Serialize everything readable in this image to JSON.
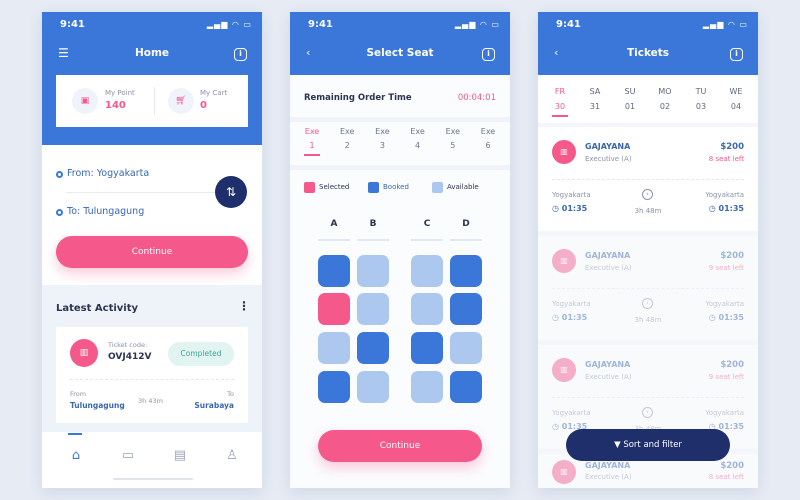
{
  "colors": {
    "primary": "#3a77d9",
    "pink": "#f5588a",
    "navy": "#1e2f6b",
    "booked": "#3a77d9",
    "available": "#adc8ef",
    "selected": "#f5588a"
  },
  "status_time": "9:41",
  "home": {
    "title": "Home",
    "point_label": "My Point",
    "point_value": "140",
    "cart_label": "My Cart",
    "cart_value": "0",
    "from": "From: Yogyakarta",
    "to": "To: Tulungagung",
    "continue": "Continue",
    "latest_title": "Latest Activity",
    "activity": {
      "code_label": "Ticket code:",
      "code": "OVJ412V",
      "status": "Completed",
      "from_label": "From",
      "from": "Tulungagung",
      "duration": "3h 43m",
      "to_label": "To",
      "to": "Surabaya"
    },
    "nav": [
      "home-icon",
      "ticket-icon",
      "document-icon",
      "profile-icon"
    ]
  },
  "seat": {
    "title": "Select Seat",
    "timer_label": "Remaining Order Time",
    "timer": "00:04:01",
    "tabs": [
      {
        "label": "Exe",
        "num": "1"
      },
      {
        "label": "Exe",
        "num": "2"
      },
      {
        "label": "Exe",
        "num": "3"
      },
      {
        "label": "Exe",
        "num": "4"
      },
      {
        "label": "Exe",
        "num": "5"
      },
      {
        "label": "Exe",
        "num": "6"
      }
    ],
    "active_tab": 0,
    "legend": {
      "selected": "Selected",
      "booked": "Booked",
      "available": "Available"
    },
    "columns": [
      "A",
      "B",
      "C",
      "D"
    ],
    "grid": [
      [
        "booked",
        "available",
        "available",
        "booked"
      ],
      [
        "selected",
        "available",
        "available",
        "booked"
      ],
      [
        "available",
        "booked",
        "booked",
        "available"
      ],
      [
        "booked",
        "available",
        "available",
        "booked"
      ]
    ],
    "continue": "Continue"
  },
  "tickets": {
    "title": "Tickets",
    "days": [
      {
        "d": "FR",
        "n": "30"
      },
      {
        "d": "SA",
        "n": "31"
      },
      {
        "d": "SU",
        "n": "01"
      },
      {
        "d": "MO",
        "n": "02"
      },
      {
        "d": "TU",
        "n": "03"
      },
      {
        "d": "WE",
        "n": "04"
      }
    ],
    "active_day": 0,
    "items": [
      {
        "name": "GAJAYANA",
        "class": "Executive (A)",
        "price": "$200",
        "seats": "8 seat left",
        "from": "Yogyakarta",
        "dep": "01:35",
        "duration": "3h 48m",
        "to": "Yogyakarta",
        "arr": "01:35"
      },
      {
        "name": "GAJAYANA",
        "class": "Executive (A)",
        "price": "$200",
        "seats": "9 seat left",
        "from": "Yogyakarta",
        "dep": "01:35",
        "duration": "3h 48m",
        "to": "Yogyakarta",
        "arr": "01:35"
      },
      {
        "name": "GAJAYANA",
        "class": "Executive (A)",
        "price": "$200",
        "seats": "9 seat left",
        "from": "Yogyakarta",
        "dep": "01:35",
        "duration": "3h 48m",
        "to": "Yogyakarta",
        "arr": "01:35"
      },
      {
        "name": "GAJAYANA",
        "class": "Executive (A)",
        "price": "$200",
        "seats": "8 seat left",
        "from": "",
        "dep": "",
        "duration": "",
        "to": "",
        "arr": ""
      }
    ],
    "sort": "Sort and filter"
  }
}
